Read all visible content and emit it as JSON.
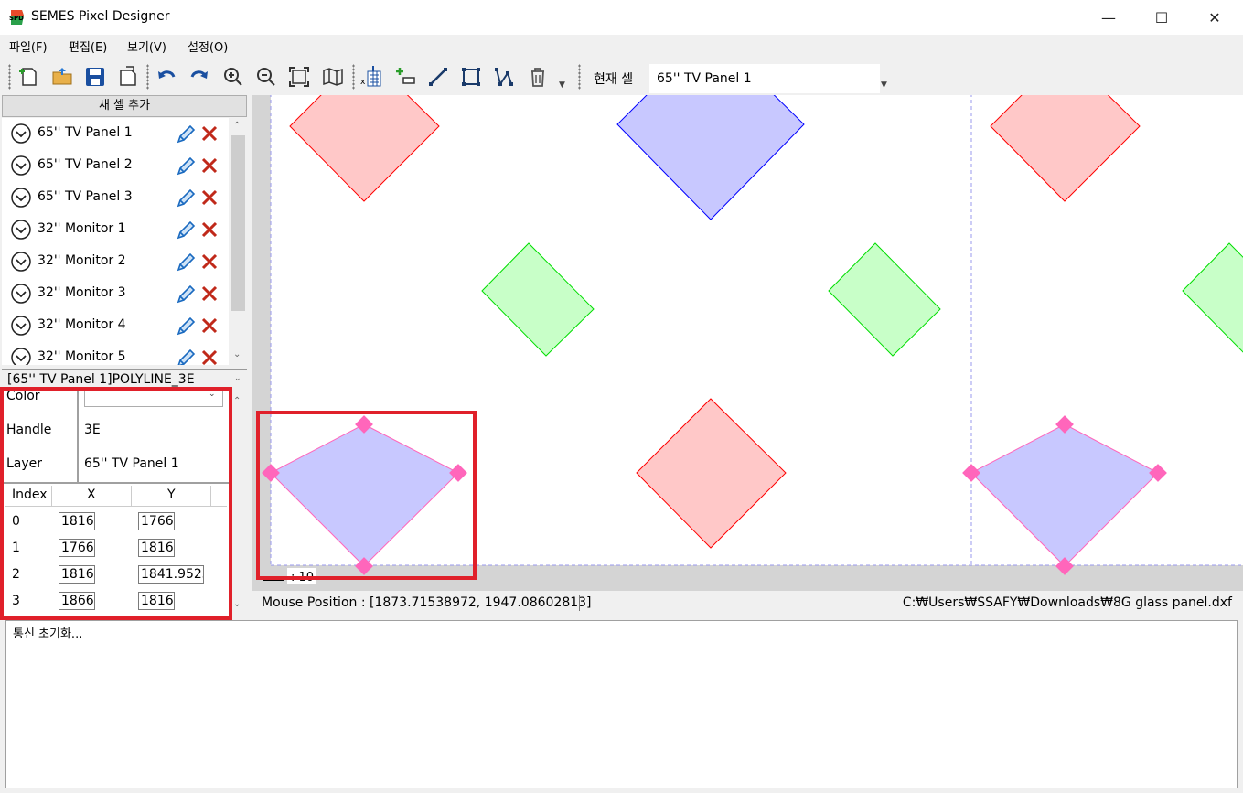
{
  "window": {
    "title": "SEMES Pixel Designer",
    "app_icon_text": "SPD"
  },
  "menu": [
    "파일(F)",
    "편집(E)",
    "보기(V)",
    "설정(O)"
  ],
  "toolbar": {
    "icons": [
      "new-file-icon",
      "open-folder-icon",
      "save-icon",
      "save-as-icon",
      "undo-icon",
      "redo-icon",
      "zoom-in-icon",
      "zoom-out-icon",
      "fit-screen-icon",
      "map-icon",
      "excel-import-icon",
      "add-point-icon",
      "line-tool-icon",
      "rectangle-tool-icon",
      "polyline-tool-icon",
      "delete-icon"
    ],
    "current_cell_label": "현재 셀",
    "current_cell_value": "65'' TV Panel 1"
  },
  "left_panel": {
    "add_cell_label": "새 셀 추가",
    "cells": [
      "65'' TV Panel 1",
      "65'' TV Panel 2",
      "65'' TV Panel 3",
      "32'' Monitor 1",
      "32'' Monitor 2",
      "32'' Monitor 3",
      "32'' Monitor 4",
      "32'' Monitor 5"
    ],
    "selected_entity": "[65'' TV Panel 1]POLYLINE_3E",
    "properties": {
      "color_label": "Color",
      "color_value": "",
      "handle_label": "Handle",
      "handle_value": "3E",
      "layer_label": "Layer",
      "layer_value": "65'' TV Panel 1"
    },
    "vertex_table": {
      "headers": [
        "Index",
        "X",
        "Y"
      ],
      "rows": [
        {
          "index": "0",
          "x": "1816",
          "y": "1766"
        },
        {
          "index": "1",
          "x": "1766",
          "y": "1816"
        },
        {
          "index": "2",
          "x": "1816",
          "y": "1841.9523"
        },
        {
          "index": "3",
          "x": "1866",
          "y": "1816"
        }
      ]
    }
  },
  "canvas": {
    "scale_label": ": 10",
    "colors": {
      "red": "#ff0000",
      "blue": "#0000ff",
      "green": "#00cc00",
      "selected": "#ff66bb"
    }
  },
  "status": {
    "mouse_position": "Mouse Position : [1873.71538972, 1947.08602813]",
    "file_path": "C:₩Users₩SSAFY₩Downloads₩8G glass panel.dxf"
  },
  "log": {
    "text": "통신 초기화..."
  }
}
